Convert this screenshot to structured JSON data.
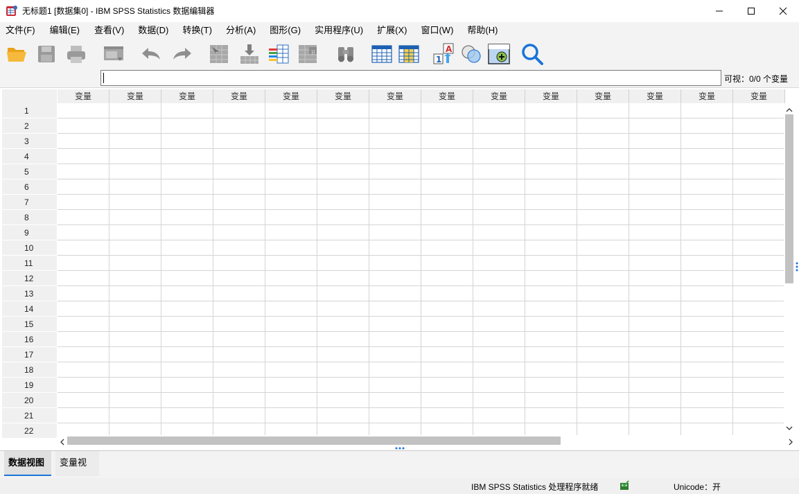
{
  "window": {
    "title": "无标题1 [数据集0] - IBM SPSS Statistics 数据编辑器"
  },
  "menu": {
    "items": [
      "文件(F)",
      "编辑(E)",
      "查看(V)",
      "数据(D)",
      "转换(T)",
      "分析(A)",
      "图形(G)",
      "实用程序(U)",
      "扩展(X)",
      "窗口(W)",
      "帮助(H)"
    ]
  },
  "toolbar": {
    "icons": [
      "open-folder-icon",
      "save-icon",
      "print-icon",
      "dialog-recall-icon",
      "undo-icon",
      "redo-icon",
      "goto-case-icon",
      "goto-variable-icon",
      "variables-icon",
      "descriptives-icon",
      "find-icon",
      "insert-cases-icon",
      "insert-variable-icon",
      "split-file-icon",
      "weight-cases-icon",
      "select-cases-icon",
      "value-labels-icon",
      "search-icon"
    ]
  },
  "editor": {
    "value": "",
    "visible_count": "可视：0/0 个变量"
  },
  "grid": {
    "column_header": "变量",
    "column_count": 14,
    "rows": [
      "1",
      "2",
      "3",
      "4",
      "5",
      "6",
      "7",
      "8",
      "9",
      "10",
      "11",
      "12",
      "13",
      "14",
      "15",
      "16",
      "17",
      "18",
      "19",
      "20",
      "21",
      "22"
    ]
  },
  "tabs": {
    "data_view": "数据视图",
    "variable_view": "变量视图"
  },
  "status": {
    "processor": "IBM SPSS Statistics 处理程序就绪",
    "unicode": "Unicode：开"
  },
  "colors": {
    "accent": "#1a73d9",
    "toolbar_bg": "#f3f3f3",
    "grid_line": "#d4d4d4"
  }
}
